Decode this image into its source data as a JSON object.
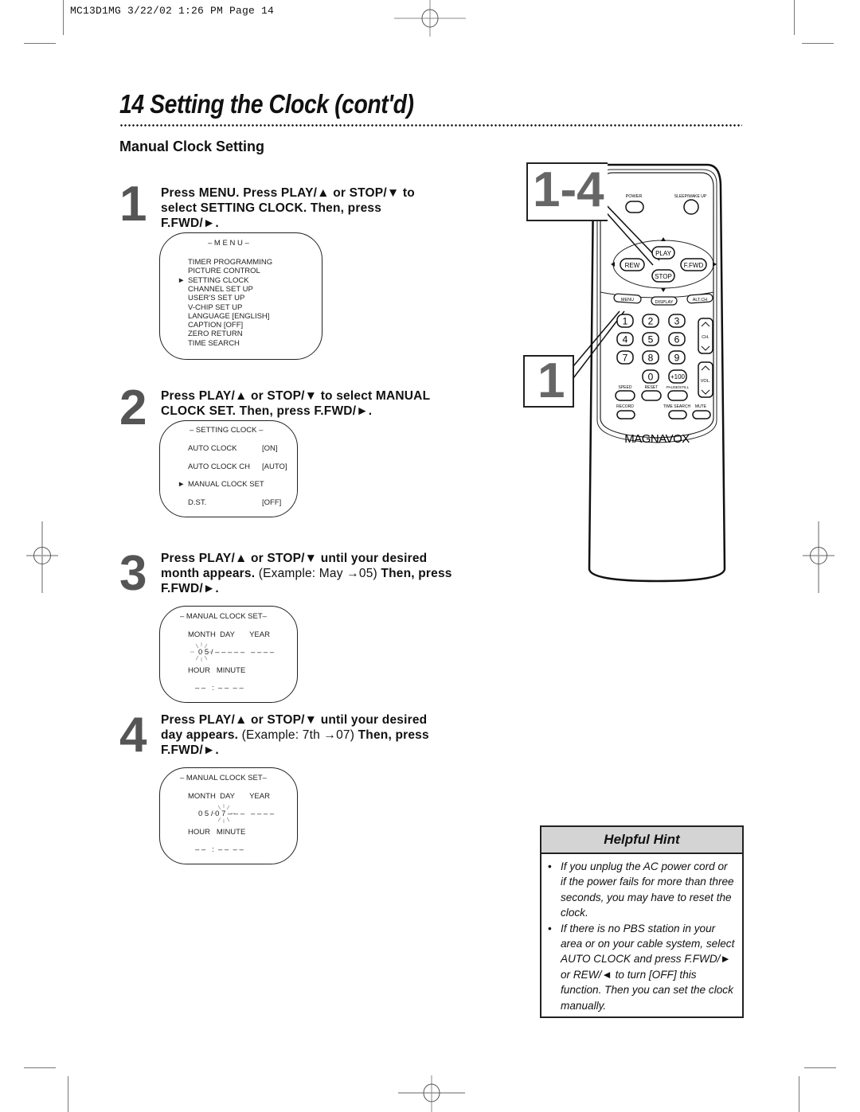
{
  "slug": "MC13D1MG  3/22/02  1:26 PM  Page 14",
  "header": {
    "title": "14  Setting the Clock (cont'd)",
    "subtitle": "Manual Clock Setting"
  },
  "steps": [
    {
      "number": "1",
      "lines": [
        "Press MENU. Press PLAY/▲ or STOP/▼ to",
        "select SETTING CLOCK. Then, press",
        "F.FWD/►."
      ],
      "screen": {
        "title": "– M E N U –",
        "items": [
          "TIMER PROGRAMMING",
          "PICTURE CONTROL",
          "SETTING CLOCK",
          "CHANNEL SET UP",
          "USER'S SET UP",
          "V-CHIP SET UP",
          "LANGUAGE [ENGLISH]",
          "CAPTION [OFF]",
          "ZERO RETURN",
          "TIME SEARCH"
        ],
        "selected_index": 2,
        "cursor": "►"
      }
    },
    {
      "number": "2",
      "lines": [
        "Press PLAY/▲ or STOP/▼ to select MANUAL",
        "CLOCK SET. Then, press F.FWD/►."
      ],
      "screen": {
        "title": "– SETTING CLOCK –",
        "rows": [
          {
            "label": "AUTO CLOCK",
            "value": "[ON]"
          },
          {
            "label": "AUTO CLOCK CH",
            "value": "[AUTO]"
          },
          {
            "label": "MANUAL CLOCK SET",
            "value": ""
          },
          {
            "label": "D.ST.",
            "value": "[OFF]"
          }
        ],
        "selected_index": 2,
        "cursor": "►"
      }
    },
    {
      "number": "3",
      "line1": "Press PLAY/▲ or STOP/▼ until your desired",
      "line2_bold": "month appears.",
      "line2_normal": " (Example: May →05) ",
      "line2_bold2": "Then, press",
      "line3": "F.FWD/►.",
      "screen": {
        "title": "– MANUAL CLOCK SET–",
        "header_row": "MONTH  DAY       YEAR",
        "date_month": "0 5",
        "date_sep": " / ",
        "date_day": "– –",
        "date_rest": " – – –   – – – –",
        "time_header": "HOUR   MINUTE",
        "time_value": "– –   :  – –  – –",
        "blinking": "month"
      }
    },
    {
      "number": "4",
      "line1": "Press PLAY/▲ or STOP/▼ until your desired",
      "line2_bold": "day appears.",
      "line2_normal": " (Example: 7th →07) ",
      "line2_bold2": "Then, press",
      "line3": "F.FWD/►.",
      "screen": {
        "title": "– MANUAL CLOCK SET–",
        "header_row": "MONTH  DAY       YEAR",
        "date_month": "0 5",
        "date_sep": " / ",
        "date_day": "0 7",
        "date_rest": " – – –   – – – –",
        "time_header": "HOUR   MINUTE",
        "time_value": "– –   :  – –  – –",
        "blinking": "day"
      }
    }
  ],
  "remote": {
    "callout_top": "1-4",
    "callout_bottom": "1",
    "brand": "MAGNAVOX",
    "labels": {
      "power": "POWER",
      "sleep": "SLEEP/WAKE UP",
      "play": "PLAY",
      "rew": "REW",
      "ffwd": "F.FWD",
      "stop": "STOP",
      "menu": "MENU",
      "display": "DISPLAY",
      "altch": "ALT.CH",
      "ch": "CH.",
      "vol": "VOL.",
      "plus100": "+100",
      "speed": "SPEED",
      "reset": "RESET",
      "pause": "PAUSE/STILL",
      "record": "RECORD",
      "timesearch": "TIME SEARCH",
      "mute": "MUTE"
    },
    "digits": [
      "1",
      "2",
      "3",
      "4",
      "5",
      "6",
      "7",
      "8",
      "9",
      "0"
    ]
  },
  "hint": {
    "title": "Helpful Hint",
    "items": [
      "If you unplug the AC power cord or if the power fails for more than three seconds, you may have to reset the clock.",
      "If there is no PBS station in your area or on your cable system, select AUTO CLOCK and press F.FWD/► or REW/◄ to turn [OFF] this function. Then you can set the clock manually."
    ]
  }
}
